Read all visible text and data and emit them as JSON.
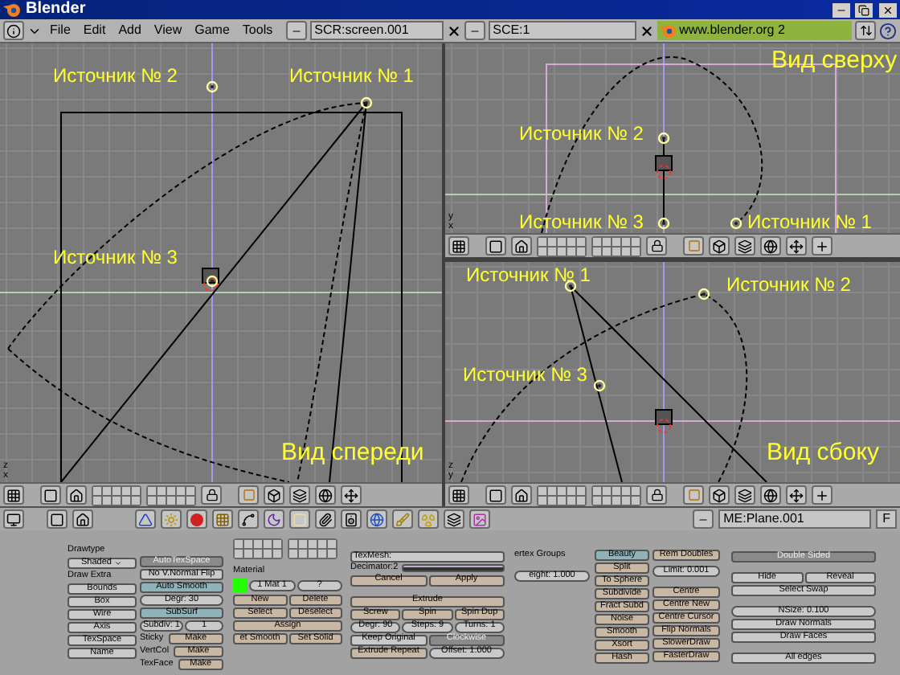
{
  "window": {
    "title": "Blender"
  },
  "menu": [
    "File",
    "Edit",
    "Add",
    "View",
    "Game",
    "Tools"
  ],
  "screen_field": "SCR:screen.001",
  "scene_field": "SCE:1",
  "url_field": "www.blender.org 2",
  "viewports": [
    {
      "view_label": "Вид спереди",
      "axis_labels": [
        "z",
        "x"
      ],
      "lights": [
        {
          "label": "Источник № 2"
        },
        {
          "label": "Источник № 1"
        },
        {
          "label": "Источник № 3"
        }
      ]
    },
    {
      "view_label": "Вид сверху",
      "axis_labels": [
        "y",
        "x"
      ],
      "lights": [
        {
          "label": "Источник № 2"
        },
        {
          "label": "Источник № 3"
        },
        {
          "label": "Источник № 1"
        }
      ]
    },
    {
      "view_label": "Вид сбоку",
      "axis_labels": [
        "z",
        "y"
      ],
      "lights": [
        {
          "label": "Источник № 1"
        },
        {
          "label": "Источник № 2"
        },
        {
          "label": "Источник № 3"
        }
      ]
    }
  ],
  "buttons_header": {
    "object_field": "ME:Plane.001",
    "f_button": "F"
  },
  "panels": [
    {
      "rows": [
        [
          {
            "kind": "label",
            "text": "Drawtype"
          }
        ],
        [
          {
            "kind": "menu",
            "text": "Shaded"
          }
        ],
        [
          {
            "kind": "label",
            "text": "Draw Extra"
          }
        ],
        [
          {
            "kind": "toggle",
            "text": "Bounds",
            "on": false
          }
        ],
        [
          {
            "kind": "toggle",
            "text": "Box",
            "on": false
          }
        ],
        [
          {
            "kind": "toggle",
            "text": "Wire",
            "on": false
          }
        ],
        [
          {
            "kind": "toggle",
            "text": "Axis",
            "on": false
          }
        ],
        [
          {
            "kind": "toggle",
            "text": "TexSpace",
            "on": false
          }
        ],
        [
          {
            "kind": "toggle",
            "text": "Name",
            "on": false
          }
        ]
      ]
    },
    {
      "rows": [
        [
          {
            "kind": "option",
            "text": "AutoTexSpace",
            "on": true
          }
        ],
        [
          {
            "kind": "option",
            "text": "No V.Normal Flip",
            "on": false
          }
        ],
        [
          {
            "kind": "toggle",
            "text": "Auto Smooth",
            "on": true
          }
        ],
        [
          {
            "kind": "field",
            "text": "Degr: 30"
          }
        ],
        [
          {
            "kind": "toggle",
            "text": "SubSurf",
            "on": true
          }
        ],
        [
          {
            "kind": "field",
            "text": "Subdiv: 1"
          },
          {
            "kind": "field",
            "text": "1"
          }
        ],
        [
          {
            "kind": "label",
            "text": "Sticky"
          },
          {
            "kind": "action",
            "text": "Make"
          }
        ],
        [
          {
            "kind": "label",
            "text": "VertCol"
          },
          {
            "kind": "action",
            "text": "Make"
          }
        ],
        [
          {
            "kind": "label",
            "text": "TexFace"
          },
          {
            "kind": "action",
            "text": "Make"
          }
        ]
      ]
    },
    {
      "rows": [
        [
          {
            "kind": "label",
            "text": "Material"
          }
        ],
        [
          {
            "kind": "swatch",
            "color": "#22ff00"
          },
          {
            "kind": "field",
            "text": "1 Mat 1"
          },
          {
            "kind": "field",
            "text": "?"
          }
        ],
        [
          {
            "kind": "action",
            "text": "New"
          },
          {
            "kind": "action",
            "text": "Delete"
          }
        ],
        [
          {
            "kind": "action",
            "text": "Select"
          },
          {
            "kind": "action",
            "text": "Deselect"
          }
        ],
        [
          {
            "kind": "action",
            "text": "Assign"
          }
        ],
        [
          {
            "kind": "action",
            "text": "et Smooth"
          },
          {
            "kind": "action",
            "text": "Set Solid"
          }
        ]
      ]
    },
    {
      "rows": [
        [
          {
            "kind": "text_field",
            "text": "TexMesh:"
          }
        ],
        [
          {
            "kind": "slider",
            "text": "Decimator:2",
            "level": 1
          }
        ],
        [
          {
            "kind": "action",
            "text": "Cancel"
          },
          {
            "kind": "action",
            "text": "Apply"
          }
        ],
        [
          {
            "kind": "action",
            "text": "Extrude"
          }
        ],
        [
          {
            "kind": "action",
            "text": "Screw"
          },
          {
            "kind": "action",
            "text": "Spin"
          },
          {
            "kind": "action",
            "text": "Spin Dup"
          }
        ],
        [
          {
            "kind": "field",
            "text": "Degr: 90"
          },
          {
            "kind": "field",
            "text": "Steps: 9"
          },
          {
            "kind": "field",
            "text": "Turns: 1"
          }
        ],
        [
          {
            "kind": "option",
            "text": "Keep Original",
            "on": false
          },
          {
            "kind": "option",
            "text": "Clockwise",
            "on": true
          }
        ],
        [
          {
            "kind": "action",
            "text": "Extrude Repeat"
          },
          {
            "kind": "field",
            "text": "Offset: 1.000"
          }
        ]
      ]
    },
    {
      "rows": [
        [
          {
            "kind": "label",
            "text": "ertex Groups"
          }
        ],
        [
          {
            "kind": "field",
            "text": "eight: 1.000"
          }
        ]
      ]
    },
    {
      "rows": [
        [
          {
            "kind": "toggle",
            "text": "Beauty",
            "on": true
          }
        ],
        [
          {
            "kind": "action",
            "text": "Split"
          }
        ],
        [
          {
            "kind": "action",
            "text": "To Sphere"
          }
        ],
        [
          {
            "kind": "action",
            "text": "Subdivide"
          }
        ],
        [
          {
            "kind": "action",
            "text": "Fract Subd"
          }
        ],
        [
          {
            "kind": "action",
            "text": "Noise"
          }
        ],
        [
          {
            "kind": "action",
            "text": "Smooth"
          }
        ],
        [
          {
            "kind": "action",
            "text": "Xsort"
          }
        ],
        [
          {
            "kind": "action",
            "text": "Hash"
          }
        ]
      ]
    },
    {
      "rows": [
        [
          {
            "kind": "action",
            "text": "Rem Doubles"
          }
        ],
        [
          {
            "kind": "field",
            "text": "Limit: 0.001"
          }
        ],
        [
          {
            "kind": "action",
            "text": "Centre"
          }
        ],
        [
          {
            "kind": "action",
            "text": "Centre New"
          }
        ],
        [
          {
            "kind": "action",
            "text": "Centre Cursor"
          }
        ],
        [
          {
            "kind": "action",
            "text": "Flip Normals"
          }
        ],
        [
          {
            "kind": "action",
            "text": "SlowerDraw"
          }
        ],
        [
          {
            "kind": "action",
            "text": "FasterDraw"
          }
        ]
      ]
    },
    {
      "rows": [
        [
          {
            "kind": "option",
            "text": "Double Sided",
            "on": true
          }
        ],
        [
          {
            "kind": "toggle",
            "text": "Hide",
            "on": false
          },
          {
            "kind": "toggle",
            "text": "Reveal",
            "on": false
          }
        ],
        [
          {
            "kind": "toggle",
            "text": "Select Swap",
            "on": false
          }
        ],
        [
          {
            "kind": "field",
            "text": "NSize: 0.100"
          }
        ],
        [
          {
            "kind": "toggle",
            "text": "Draw Normals",
            "on": false
          }
        ],
        [
          {
            "kind": "toggle",
            "text": "Draw Faces",
            "on": false
          }
        ],
        [
          {
            "kind": "toggle",
            "text": "All edges",
            "on": false
          }
        ]
      ]
    }
  ]
}
